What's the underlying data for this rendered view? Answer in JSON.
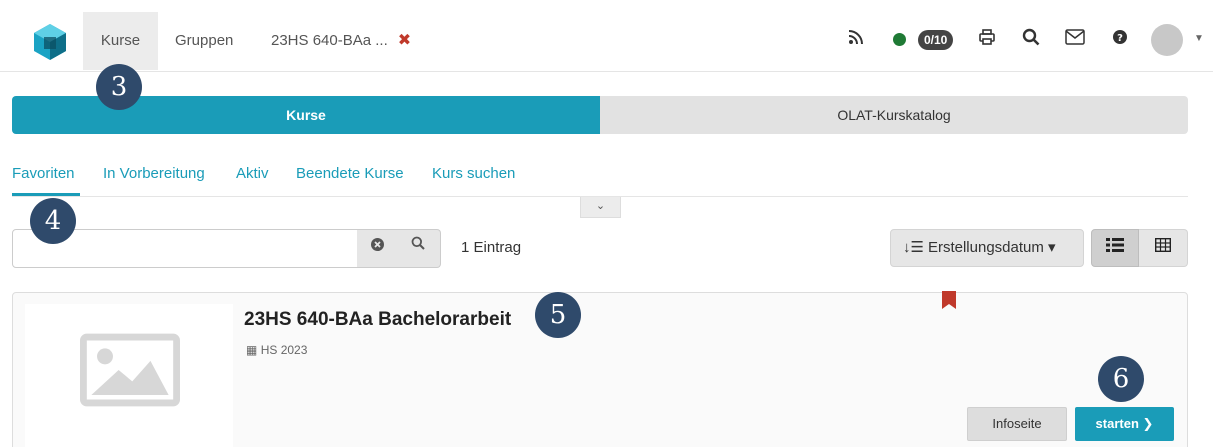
{
  "nav": {
    "tabs": [
      {
        "label": "Kurse",
        "active": true
      },
      {
        "label": "Gruppen",
        "active": false
      },
      {
        "label": "23HS 640-BAa ...",
        "active": false
      }
    ],
    "tab_close_symbol": "✖",
    "notification_count": "0/10",
    "status_color": "#1f7a35",
    "icons": [
      "rss-icon",
      "status-dot-icon",
      "print-icon",
      "search-icon",
      "mail-icon",
      "help-icon",
      "avatar",
      "chevron-down-icon"
    ]
  },
  "markers": [
    "3",
    "4",
    "5",
    "6"
  ],
  "segments": {
    "kurse": "Kurse",
    "katalog": "OLAT-Kurskatalog"
  },
  "subtabs": [
    "Favoriten",
    "In Vorbereitung",
    "Aktiv",
    "Beendete Kurse",
    "Kurs suchen"
  ],
  "search": {
    "value": "",
    "result_count": "1 Eintrag"
  },
  "sort": {
    "label": "Erstellungsdatum"
  },
  "course": {
    "title": "23HS 640-BAa Bachelorarbeit",
    "semester": "HS 2023",
    "info_label": "Infoseite",
    "start_label": "starten"
  },
  "colors": {
    "accent": "#1a9cb8",
    "bookmark": "#c0392b",
    "marker": "#2f4a6b"
  }
}
